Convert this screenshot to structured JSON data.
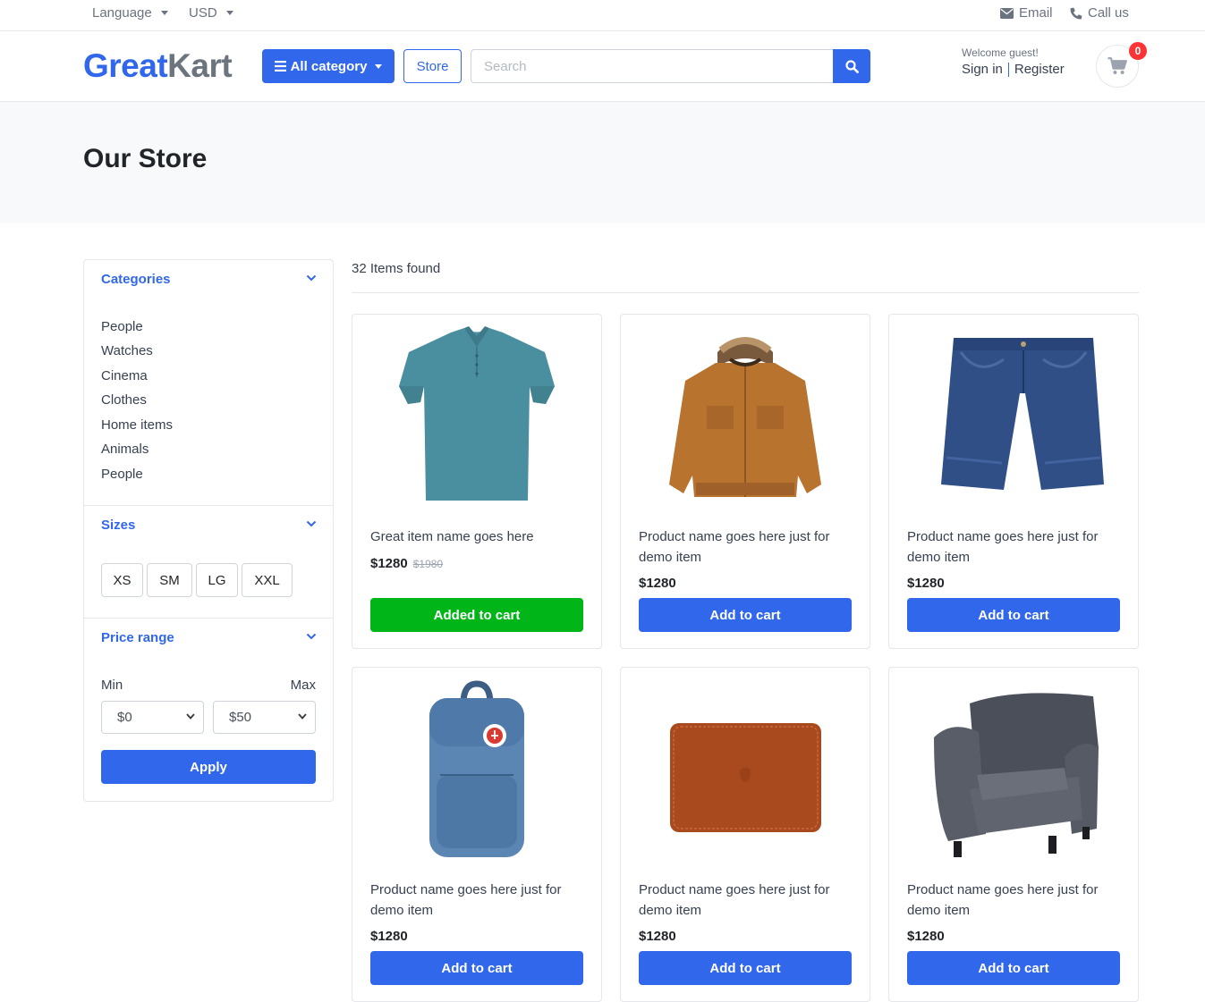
{
  "topbar": {
    "language": "Language",
    "currency": "USD",
    "email": "Email",
    "call": "Call us"
  },
  "header": {
    "logo_part1": "Great",
    "logo_part2": "Kart",
    "all_category": "All category",
    "store": "Store",
    "search_placeholder": "Search",
    "welcome": "Welcome guest!",
    "sign_in": "Sign in",
    "register": "Register",
    "cart_count": "0"
  },
  "page": {
    "title": "Our Store"
  },
  "sidebar": {
    "categories_title": "Categories",
    "categories": [
      "People",
      "Watches",
      "Cinema",
      "Clothes",
      "Home items",
      "Animals",
      "People"
    ],
    "sizes_title": "Sizes",
    "sizes": [
      "XS",
      "SM",
      "LG",
      "XXL"
    ],
    "price_title": "Price range",
    "min_label": "Min",
    "max_label": "Max",
    "min_value": "$0",
    "max_value": "$50",
    "apply": "Apply"
  },
  "results": {
    "count_text": "32 Items found",
    "products": [
      {
        "name": "Great item name goes here",
        "price": "$1280",
        "old_price": "$1980",
        "button": "Added to cart",
        "image": "polo-shirt",
        "added": true
      },
      {
        "name": "Product name goes here just for demo item",
        "price": "$1280",
        "button": "Add to cart",
        "image": "jacket"
      },
      {
        "name": "Product name goes here just for demo item",
        "price": "$1280",
        "button": "Add to cart",
        "image": "denim-shorts"
      },
      {
        "name": "Product name goes here just for demo item",
        "price": "$1280",
        "button": "Add to cart",
        "image": "backpack"
      },
      {
        "name": "Product name goes here just for demo item",
        "price": "$1280",
        "button": "Add to cart",
        "image": "laptop-sleeve"
      },
      {
        "name": "Product name goes here just for demo item",
        "price": "$1280",
        "button": "Add to cart",
        "image": "armchair"
      }
    ]
  },
  "colors": {
    "primary": "#3167eb",
    "added": "#00b517",
    "badge": "#fa3434"
  }
}
